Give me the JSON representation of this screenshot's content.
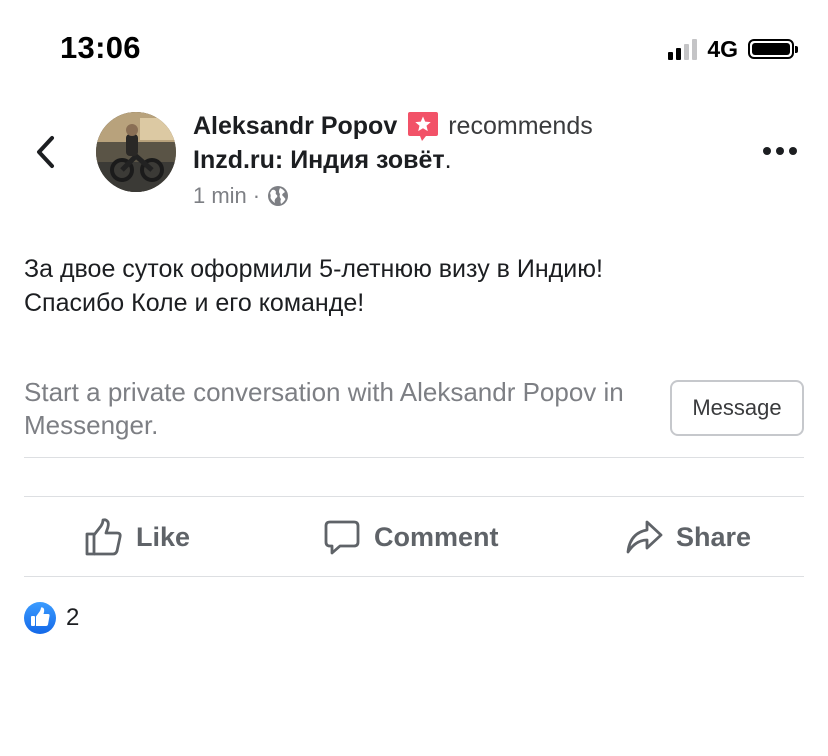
{
  "status_bar": {
    "time": "13:06",
    "network": "4G",
    "signal_bars_active": 2,
    "signal_bars_total": 4,
    "battery_level": 1.0
  },
  "post": {
    "author": "Aleksandr Popov",
    "action": "recommends",
    "page_name": "Inzd.ru: Индия зовёт",
    "page_name_suffix": ".",
    "time": "1 min",
    "separator": "·",
    "privacy_icon": "globe-icon",
    "text_lines": [
      "За двое суток оформили 5-летнюю визу в Индию!",
      "Спасибо Коле и его команде!"
    ]
  },
  "messenger": {
    "prompt": "Start a private conversation with Aleksandr Popov in Messenger.",
    "button_label": "Message"
  },
  "actions": {
    "like": "Like",
    "comment": "Comment",
    "share": "Share"
  },
  "reactions": {
    "count": "2",
    "icon": "like-reaction-icon"
  },
  "colors": {
    "like_blue": "#1877f2",
    "badge_red": "#f25268",
    "secondary_text": "#7d7f84"
  }
}
